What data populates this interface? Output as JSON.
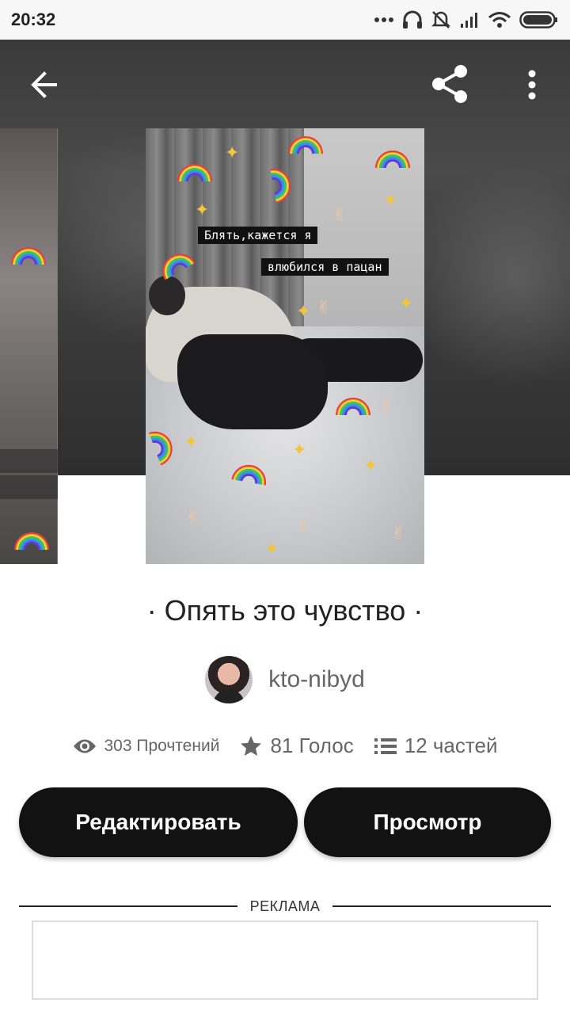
{
  "status_bar": {
    "time": "20:32",
    "icons": [
      "dots-icon",
      "headphones-icon",
      "muted-bell-icon",
      "signal-icon",
      "wifi-icon",
      "battery-icon"
    ]
  },
  "topbar": {
    "back_icon": "arrow-left-icon",
    "share_icon": "share-icon",
    "more_icon": "more-vertical-icon"
  },
  "cover": {
    "caption_line1": "Блять,кажется я",
    "caption_line2": "влюбился в пацан"
  },
  "story": {
    "title": "· Опять это чувство ·",
    "author": "kto-nibyd"
  },
  "stats": {
    "reads": "303 Прочтений",
    "votes": "81 Голос",
    "parts": "12 частей"
  },
  "actions": {
    "edit_label": "Редактировать",
    "view_label": "Просмотр"
  },
  "ad": {
    "label": "РЕКЛАМА"
  }
}
